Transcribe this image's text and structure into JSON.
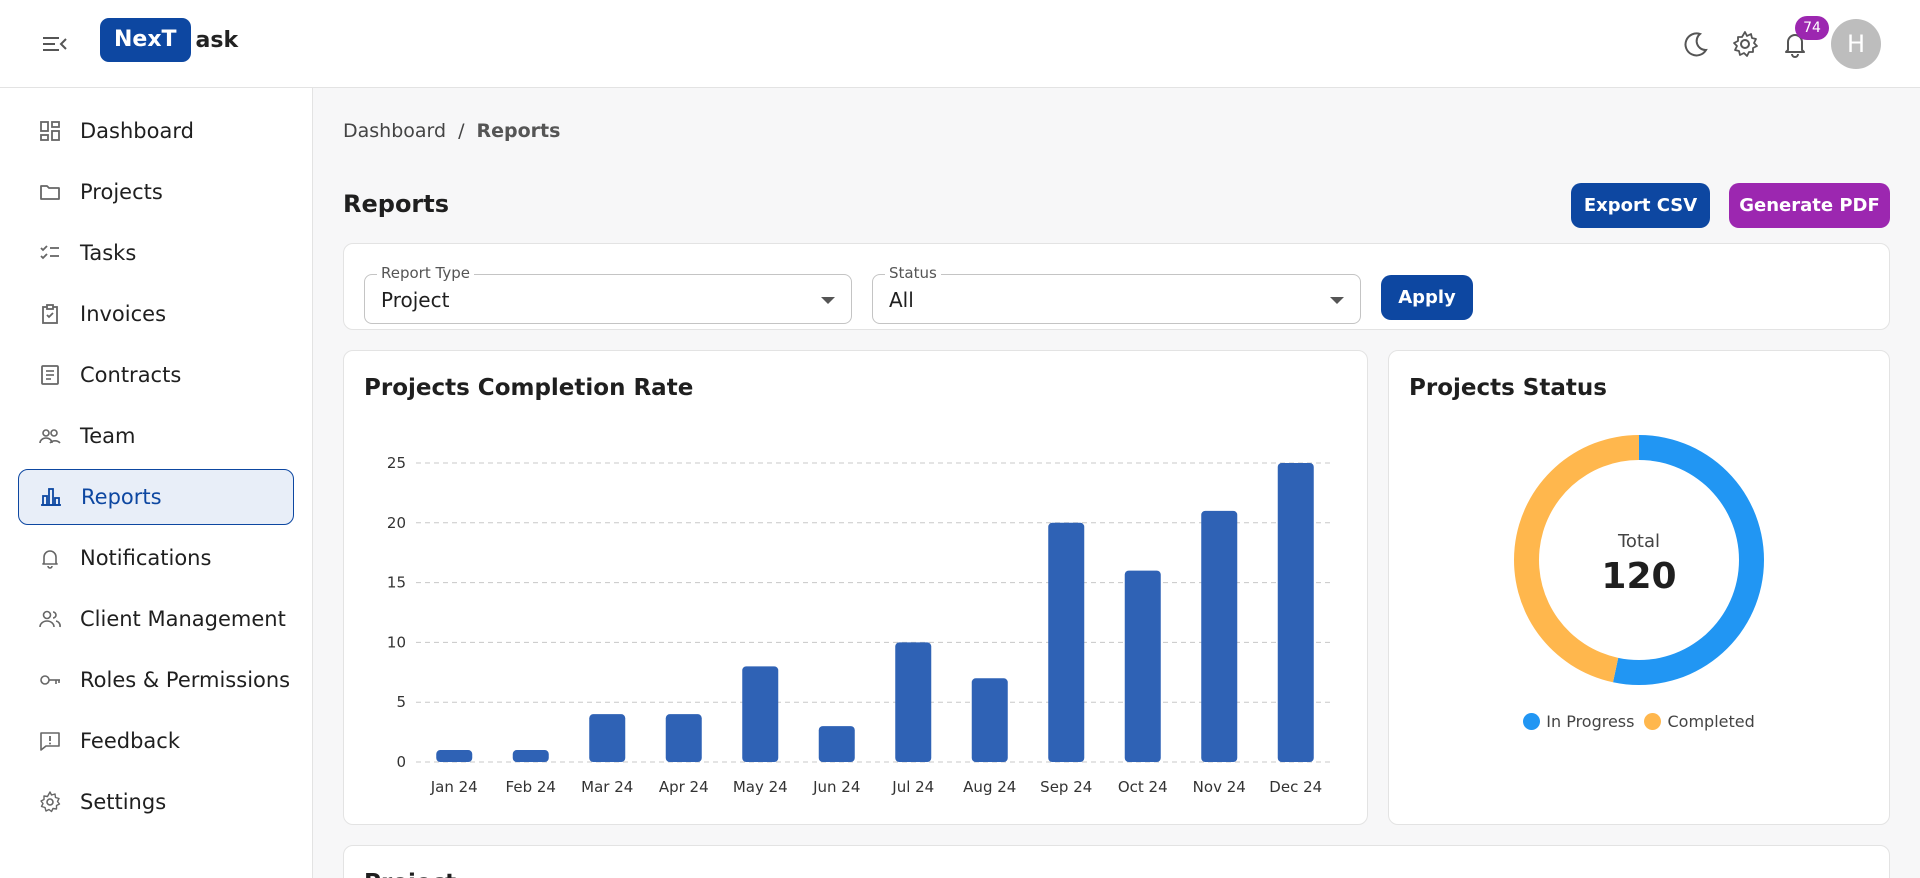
{
  "header": {
    "logo_box": "NexT",
    "logo_rest": "ask",
    "notification_count": "74",
    "avatar_initial": "H",
    "icons": [
      "menu-collapse-icon",
      "moon-icon",
      "gear-icon",
      "bell-icon"
    ]
  },
  "sidebar": {
    "items": [
      {
        "label": "Dashboard",
        "icon": "dashboard-icon"
      },
      {
        "label": "Projects",
        "icon": "folder-icon"
      },
      {
        "label": "Tasks",
        "icon": "checklist-icon"
      },
      {
        "label": "Invoices",
        "icon": "clipboard-check-icon"
      },
      {
        "label": "Contracts",
        "icon": "document-icon"
      },
      {
        "label": "Team",
        "icon": "team-icon"
      },
      {
        "label": "Reports",
        "icon": "bar-chart-icon",
        "active": true
      },
      {
        "label": "Notifications",
        "icon": "bell-icon"
      },
      {
        "label": "Client Management",
        "icon": "clients-icon"
      },
      {
        "label": "Roles & Permissions",
        "icon": "key-icon"
      },
      {
        "label": "Feedback",
        "icon": "feedback-icon"
      },
      {
        "label": "Settings",
        "icon": "gear-icon"
      }
    ]
  },
  "breadcrumb": {
    "root": "Dashboard",
    "separator": "/",
    "current": "Reports"
  },
  "page": {
    "title": "Reports",
    "export_csv_label": "Export CSV",
    "generate_pdf_label": "Generate PDF"
  },
  "filters": {
    "report_type_label": "Report Type",
    "report_type_value": "Project",
    "status_label": "Status",
    "status_value": "All",
    "apply_label": "Apply"
  },
  "completion_card": {
    "title": "Projects Completion Rate"
  },
  "status_card": {
    "title": "Projects Status",
    "total_label": "Total",
    "total_value": "120",
    "legend_in_progress": "In Progress",
    "legend_completed": "Completed"
  },
  "bottom_card": {
    "partial_title": "Project"
  },
  "colors": {
    "primary": "#0d47a1",
    "purple": "#9c27b0",
    "bar": "#2f62b5",
    "in_progress": "#2196f3",
    "completed": "#ffb74d"
  },
  "chart_data": [
    {
      "type": "bar",
      "title": "Projects Completion Rate",
      "categories": [
        "Jan 24",
        "Feb 24",
        "Mar 24",
        "Apr 24",
        "May 24",
        "Jun 24",
        "Jul 24",
        "Aug 24",
        "Sep 24",
        "Oct 24",
        "Nov 24",
        "Dec 24"
      ],
      "values": [
        1,
        1,
        4,
        4,
        8,
        3,
        10,
        7,
        20,
        16,
        21,
        25
      ],
      "yticks": [
        0,
        5,
        10,
        15,
        20,
        25
      ],
      "ylim": [
        0,
        25
      ],
      "grid": true
    },
    {
      "type": "pie",
      "title": "Projects Status",
      "labels": [
        "In Progress",
        "Completed"
      ],
      "values": [
        64,
        56
      ],
      "total": 120,
      "legend": "bottom"
    }
  ]
}
